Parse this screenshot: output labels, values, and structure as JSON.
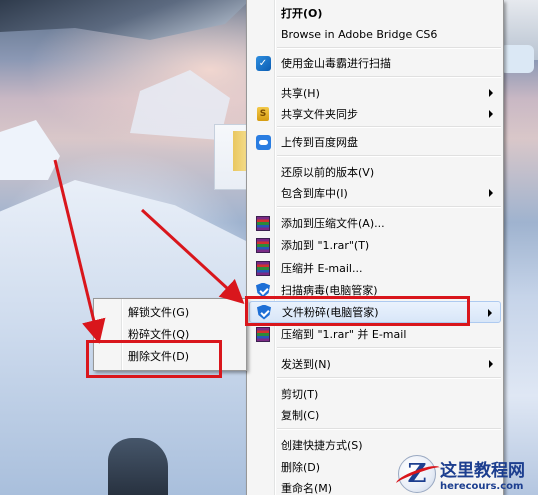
{
  "main_menu": {
    "items": [
      {
        "label": "打开(O)"
      },
      {
        "label": "Browse in Adobe Bridge CS6"
      },
      {
        "label": "使用金山毒霸进行扫描"
      },
      {
        "label": "共享(H)"
      },
      {
        "label": "共享文件夹同步"
      },
      {
        "label": "上传到百度网盘"
      },
      {
        "label": "还原以前的版本(V)"
      },
      {
        "label": "包含到库中(I)"
      },
      {
        "label": "添加到压缩文件(A)..."
      },
      {
        "label": "添加到 \"1.rar\"(T)"
      },
      {
        "label": "压缩并 E-mail..."
      },
      {
        "label": "扫描病毒(电脑管家)"
      },
      {
        "label": "文件粉碎(电脑管家)"
      },
      {
        "label": "压缩到 \"1.rar\" 并 E-mail"
      },
      {
        "label": "发送到(N)"
      },
      {
        "label": "剪切(T)"
      },
      {
        "label": "复制(C)"
      },
      {
        "label": "创建快捷方式(S)"
      },
      {
        "label": "删除(D)"
      },
      {
        "label": "重命名(M)"
      }
    ]
  },
  "sub_menu": {
    "items": [
      {
        "label": "解锁文件(G)"
      },
      {
        "label": "粉碎文件(Q)"
      },
      {
        "label": "删除文件(D)"
      }
    ]
  },
  "icons": {
    "scan": "kingsoft-scan-icon",
    "sync": "folder-sync-icon",
    "cloud": "baidu-cloud-icon",
    "rar": "winrar-icon",
    "shield": "pc-manager-shield-icon"
  },
  "colors": {
    "highlight": "#d9161c",
    "menu_bg": "#f5f5f5",
    "hover_border": "#aecaf0"
  },
  "watermark": {
    "logo_letter": "Z",
    "title": "这里教程网",
    "url": "herecours.com"
  }
}
